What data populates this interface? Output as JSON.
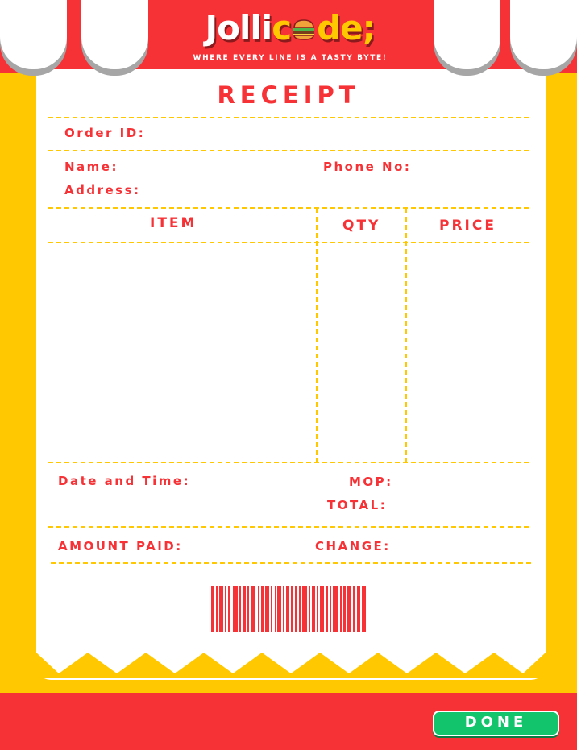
{
  "brand": {
    "logo_part1": "Jolli",
    "logo_part2": "c",
    "logo_part3": "de;",
    "logo_icon": "burger-icon",
    "tagline": "WHERE EVERY LINE IS A TASTY BYTE!"
  },
  "receipt": {
    "title": "RECEIPT",
    "order_id_label": "Order ID:",
    "name_label": "Name:",
    "phone_label": "Phone No:",
    "address_label": "Address:",
    "columns": {
      "item": "ITEM",
      "qty": "QTY",
      "price": "PRICE"
    },
    "items": [],
    "datetime_label": "Date and Time:",
    "mop_label": "MOP:",
    "total_label": "TOTAL:",
    "amount_paid_label": "AMOUNT PAID:",
    "change_label": "CHANGE:",
    "barcode_icon": "barcode-icon"
  },
  "footer": {
    "done_label": "DONE"
  },
  "colors": {
    "red": "#F63236",
    "yellow": "#FFC800",
    "white": "#FFFFFF",
    "green": "#12C56D"
  }
}
